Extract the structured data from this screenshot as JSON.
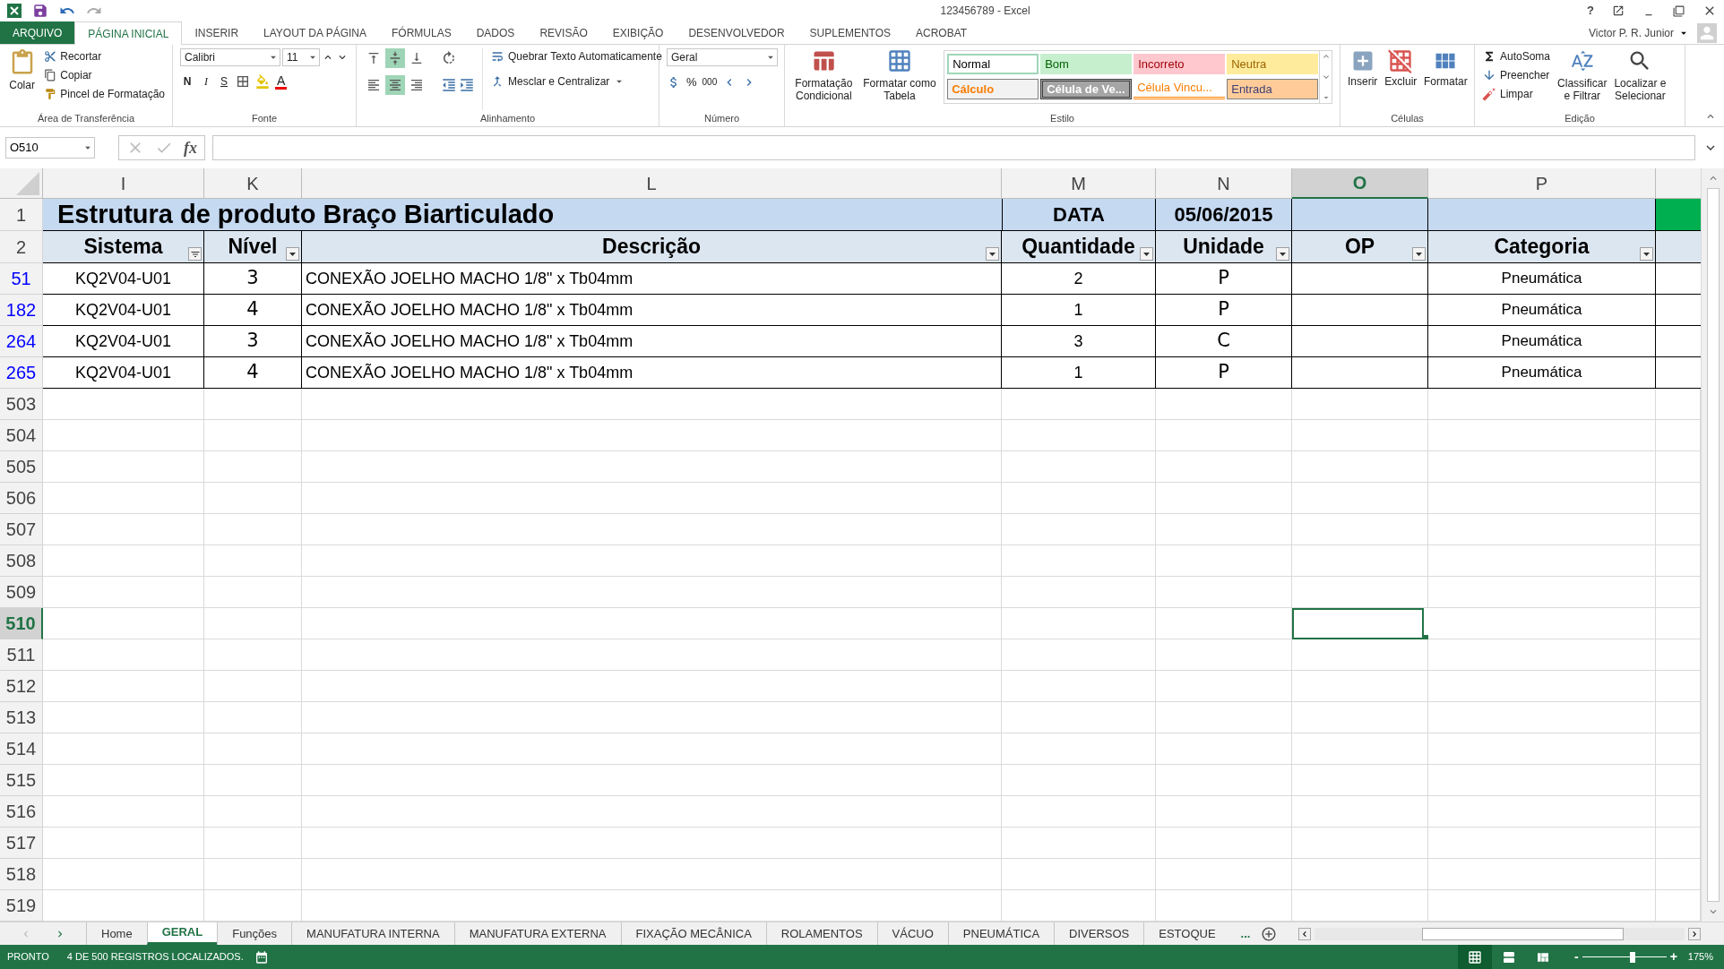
{
  "title_bar": {
    "title": "123456789 - Excel",
    "help": "?"
  },
  "menu_tabs": [
    {
      "label": "ARQUIVO",
      "kind": "file",
      "selected": false
    },
    {
      "label": "PÁGINA INICIAL",
      "kind": "tab",
      "selected": true
    },
    {
      "label": "INSERIR",
      "kind": "tab",
      "selected": false
    },
    {
      "label": "LAYOUT DA PÁGINA",
      "kind": "tab",
      "selected": false
    },
    {
      "label": "FÓRMULAS",
      "kind": "tab",
      "selected": false
    },
    {
      "label": "DADOS",
      "kind": "tab",
      "selected": false
    },
    {
      "label": "REVISÃO",
      "kind": "tab",
      "selected": false
    },
    {
      "label": "EXIBIÇÃO",
      "kind": "tab",
      "selected": false
    },
    {
      "label": "DESENVOLVEDOR",
      "kind": "tab",
      "selected": false
    },
    {
      "label": "SUPLEMENTOS",
      "kind": "tab",
      "selected": false
    },
    {
      "label": "ACROBAT",
      "kind": "tab",
      "selected": false
    }
  ],
  "user": "Victor P. R. Junior",
  "ribbon": {
    "clipboard": {
      "paste": "Colar",
      "cut": "Recortar",
      "copy": "Copiar",
      "painter": "Pincel de Formatação",
      "group": "Área de Transferência"
    },
    "font": {
      "name": "Calibri",
      "size": "11",
      "bold": "N",
      "italic": "I",
      "underline": "S",
      "font_color_label": "A",
      "group": "Fonte"
    },
    "alignment": {
      "vertical": [
        {
          "selected": false
        },
        {
          "selected": true
        },
        {
          "selected": false
        }
      ],
      "horizontal": [
        {
          "selected": false
        },
        {
          "selected": true
        },
        {
          "selected": false
        }
      ],
      "wrap": "Quebrar Texto Automaticamente",
      "merge": "Mesclar e Centralizar",
      "group": "Alinhamento"
    },
    "number": {
      "format": "Geral",
      "percent": "%",
      "thousands": "000",
      "group": "Número"
    },
    "styles": {
      "conditional": [
        "Formatação",
        "Condicional"
      ],
      "table": [
        "Formatar como",
        "Tabela"
      ],
      "cells": [
        {
          "label": "Normal",
          "kind": "normal"
        },
        {
          "label": "Bom",
          "kind": "good"
        },
        {
          "label": "Incorreto",
          "kind": "bad"
        },
        {
          "label": "Neutra",
          "kind": "neutral"
        },
        {
          "label": "Cálculo",
          "kind": "calc"
        },
        {
          "label": "Célula de Ve...",
          "kind": "check"
        },
        {
          "label": "Célula Vincu...",
          "kind": "linked"
        },
        {
          "label": "Entrada",
          "kind": "input"
        }
      ],
      "group": "Estilo"
    },
    "cells": {
      "insert": "Inserir",
      "delete": "Excluir",
      "format": "Formatar",
      "group": "Células"
    },
    "editing": {
      "autosum": "AutoSoma",
      "fill": "Preencher",
      "clear": "Limpar",
      "sort": [
        "Classificar",
        "e Filtrar"
      ],
      "find": [
        "Localizar e",
        "Selecionar"
      ],
      "group": "Edição"
    }
  },
  "formula_bar": {
    "name_box": "O510",
    "fx": "fx"
  },
  "sheet": {
    "columns": [
      {
        "label": "I",
        "selected": false
      },
      {
        "label": "K",
        "selected": false
      },
      {
        "label": "L",
        "selected": false
      },
      {
        "label": "M",
        "selected": false
      },
      {
        "label": "N",
        "selected": false
      },
      {
        "label": "O",
        "selected": true
      },
      {
        "label": "P",
        "selected": false
      }
    ],
    "title_row": {
      "number": "1",
      "title": "Estrutura de produto Braço Biarticulado",
      "date_label": "DATA",
      "date": "05/06/2015"
    },
    "header_row": {
      "number": "2",
      "cells": [
        {
          "label": "Sistema",
          "filtered": true
        },
        {
          "label": "Nível",
          "filtered": false
        },
        {
          "label": "Descrição",
          "filtered": false
        },
        {
          "label": "Quantidade",
          "filtered": false
        },
        {
          "label": "Unidade",
          "filtered": false
        },
        {
          "label": "OP",
          "filtered": false
        },
        {
          "label": "Categoria",
          "filtered": false
        }
      ]
    },
    "data_rows": [
      {
        "number": "51",
        "sistema": "KQ2V04-U01",
        "nivel": "3",
        "descricao": "CONEXÃO JOELHO MACHO 1/8\" x Tb04mm",
        "quantidade": "2",
        "unidade": "P",
        "categoria": "Pneumática"
      },
      {
        "number": "182",
        "sistema": "KQ2V04-U01",
        "nivel": "4",
        "descricao": "CONEXÃO JOELHO MACHO 1/8\" x Tb04mm",
        "quantidade": "1",
        "unidade": "P",
        "categoria": "Pneumática"
      },
      {
        "number": "264",
        "sistema": "KQ2V04-U01",
        "nivel": "3",
        "descricao": "CONEXÃO JOELHO MACHO 1/8\" x Tb04mm",
        "quantidade": "3",
        "unidade": "C",
        "categoria": "Pneumática"
      },
      {
        "number": "265",
        "sistema": "KQ2V04-U01",
        "nivel": "4",
        "descricao": "CONEXÃO JOELHO MACHO 1/8\" x Tb04mm",
        "quantidade": "1",
        "unidade": "P",
        "categoria": "Pneumática"
      }
    ],
    "empty_rows": [
      {
        "number": "503",
        "selected": false
      },
      {
        "number": "504",
        "selected": false
      },
      {
        "number": "505",
        "selected": false
      },
      {
        "number": "506",
        "selected": false
      },
      {
        "number": "507",
        "selected": false
      },
      {
        "number": "508",
        "selected": false
      },
      {
        "number": "509",
        "selected": false
      },
      {
        "number": "510",
        "selected": true
      },
      {
        "number": "511",
        "selected": false
      },
      {
        "number": "512",
        "selected": false
      },
      {
        "number": "513",
        "selected": false
      },
      {
        "number": "514",
        "selected": false
      },
      {
        "number": "515",
        "selected": false
      },
      {
        "number": "516",
        "selected": false
      },
      {
        "number": "517",
        "selected": false
      },
      {
        "number": "518",
        "selected": false
      },
      {
        "number": "519",
        "selected": false
      }
    ]
  },
  "sheet_tabs": [
    {
      "label": "Home",
      "selected": false
    },
    {
      "label": "GERAL",
      "selected": true
    },
    {
      "label": "Funções",
      "selected": false
    },
    {
      "label": "MANUFATURA INTERNA",
      "selected": false
    },
    {
      "label": "MANUFATURA EXTERNA",
      "selected": false
    },
    {
      "label": "FIXAÇÃO MECÂNICA",
      "selected": false
    },
    {
      "label": "ROLAMENTOS",
      "selected": false
    },
    {
      "label": "VÁCUO",
      "selected": false
    },
    {
      "label": "PNEUMÁTICA",
      "selected": false
    },
    {
      "label": "DIVERSOS",
      "selected": false
    },
    {
      "label": "ESTOQUE",
      "selected": false
    }
  ],
  "more_tabs": "...",
  "status_bar": {
    "mode": "PRONTO",
    "message": "4 DE 500 REGISTROS LOCALIZADOS.",
    "views": [
      {
        "kind": "normal",
        "selected": true
      },
      {
        "kind": "layout",
        "selected": false
      },
      {
        "kind": "pagebreak",
        "selected": false
      }
    ],
    "zoom": {
      "minus": "-",
      "plus": "+",
      "label": "175%",
      "level": 0.6
    }
  }
}
